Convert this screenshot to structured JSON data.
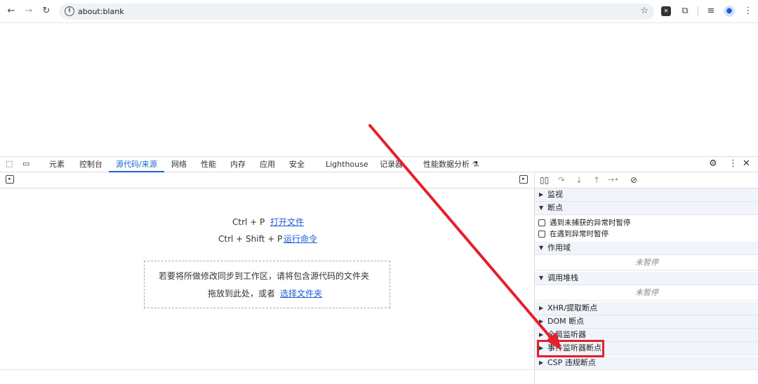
{
  "browser": {
    "url": "about:blank",
    "icons": [
      "back-icon",
      "forward-icon",
      "reload-icon",
      "info-icon",
      "bookmark-star-icon",
      "extension-icon",
      "puzzle-icon",
      "media-icon",
      "profile-icon",
      "menu-icon"
    ]
  },
  "devtools": {
    "tabs": [
      "元素",
      "控制台",
      "源代码/来源",
      "网络",
      "性能",
      "内存",
      "应用",
      "安全",
      "Lighthouse",
      "记录器",
      "性能数据分析 ⚗"
    ],
    "active_tab": "源代码/来源",
    "center": {
      "open_file_shortcut": "Ctrl + P",
      "open_file_link": "打开文件",
      "run_command_shortcut": "Ctrl + Shift + P",
      "run_command_link": "运行命令",
      "workspace_line1": "若要将所做修改同步到工作区，请将包含源代码的文件夹",
      "workspace_line2_prefix": "拖放到此处，或者 ",
      "workspace_link": "选择文件夹"
    },
    "debugger": {
      "watch": "监视",
      "breakpoints": "断点",
      "pause_uncaught": "遇到未捕获的异常时暂停",
      "pause_caught": "在遇到异常时暂停",
      "scope": "作用域",
      "scope_status": "未暂停",
      "call_stack": "调用堆栈",
      "call_stack_status": "未暂停",
      "xhr": "XHR/提取断点",
      "dom": "DOM 断点",
      "global_listeners": "全局监听器",
      "event_listeners": "事件监听器断点",
      "csp": "CSP 违规断点"
    }
  },
  "annotation": {
    "color": "#e5202a"
  }
}
